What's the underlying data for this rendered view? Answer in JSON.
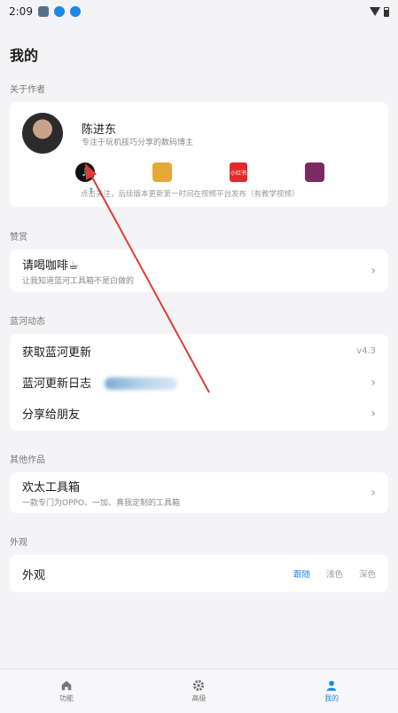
{
  "status_bar": {
    "time": "2:09"
  },
  "page": {
    "title": "我的"
  },
  "about": {
    "section_label": "关于作者",
    "name": "陈进东",
    "desc": "专注于玩机技巧分享的数码博主",
    "socials": [
      {
        "icon": "tiktok-icon"
      },
      {
        "icon": "bilibili-icon"
      },
      {
        "icon": "xiaohongshu-icon",
        "label": "小红书"
      },
      {
        "icon": "tv-icon"
      }
    ],
    "follow_note": "点击关注，后续版本更新第一时间在视频平台发布（有教学视频）"
  },
  "appreciate": {
    "section_label": "赞赏",
    "title": "请喝咖啡☕",
    "sub": "让我知道蓝河工具箱不是白做的"
  },
  "news": {
    "section_label": "蓝河动态",
    "rows": [
      {
        "title": "获取蓝河更新",
        "trailing": "v4.3"
      },
      {
        "title": "蓝河更新日志",
        "trailing": ""
      },
      {
        "title": "分享给朋友",
        "trailing": ""
      }
    ]
  },
  "other": {
    "section_label": "其他作品",
    "title": "欢太工具箱",
    "sub": "一款专门为OPPO、一加、真我定制的工具箱"
  },
  "appearance": {
    "section_label": "外观",
    "title": "外观",
    "options": [
      "跟随",
      "浅色",
      "深色"
    ],
    "selected": "跟随"
  },
  "bottom_nav": {
    "items": [
      {
        "label": "功能",
        "icon": "home-icon"
      },
      {
        "label": "高级",
        "icon": "gear-icon"
      },
      {
        "label": "我的",
        "icon": "person-icon"
      }
    ],
    "active": "我的"
  },
  "colors": {
    "accent": "#1e88e5",
    "annotation_arrow": "#e53935"
  }
}
